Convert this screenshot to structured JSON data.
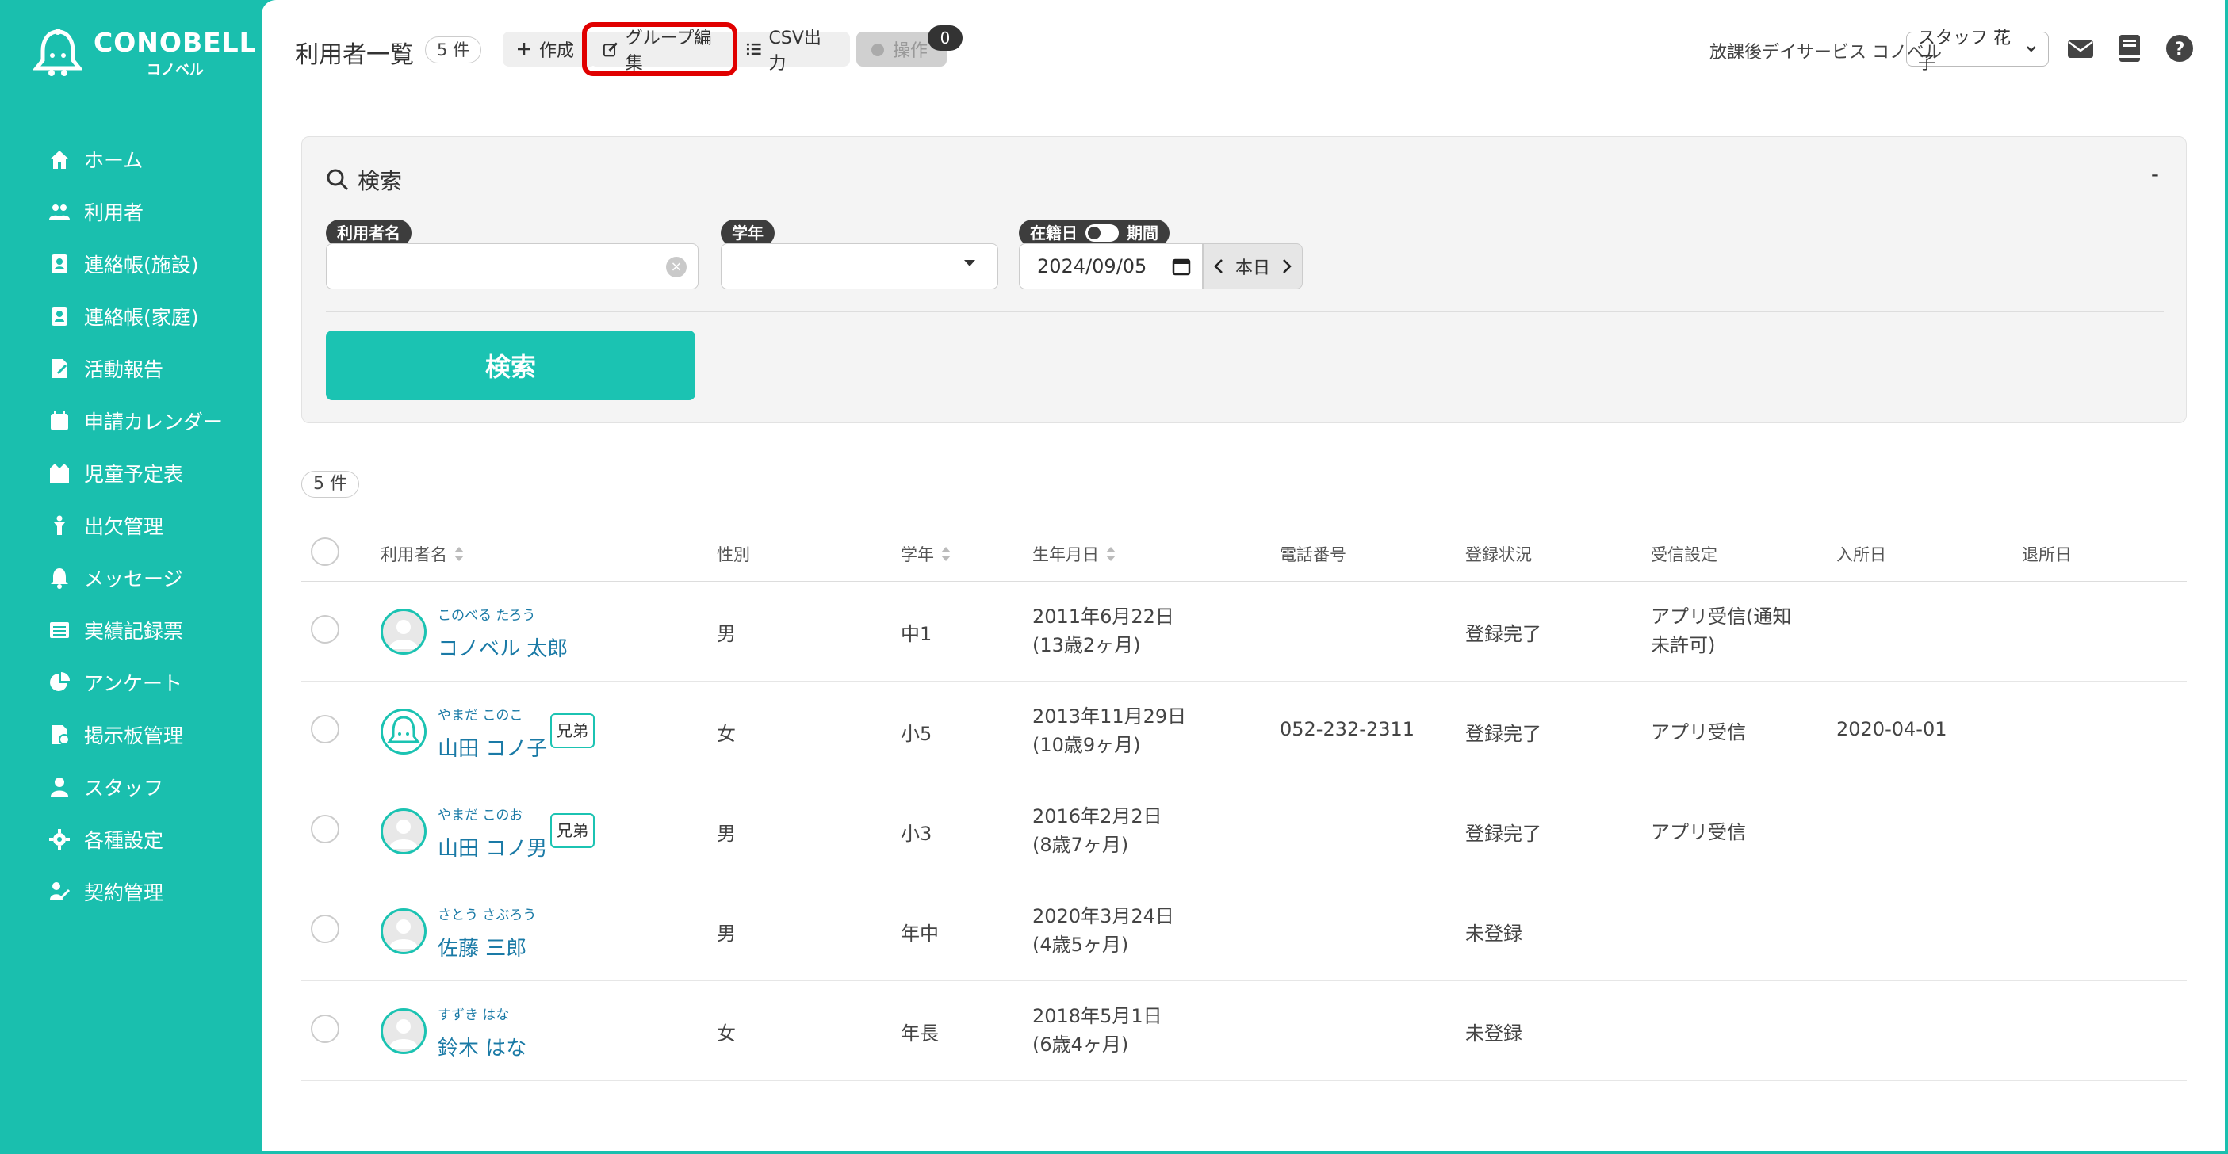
{
  "brand": {
    "name": "CONOBELL",
    "sub": "コノベル"
  },
  "sidebar": {
    "items": [
      {
        "label": "ホーム",
        "icon": "home-icon"
      },
      {
        "label": "利用者",
        "icon": "users-icon"
      },
      {
        "label": "連絡帳(施設)",
        "icon": "contact-book-icon"
      },
      {
        "label": "連絡帳(家庭)",
        "icon": "contact-book-icon"
      },
      {
        "label": "活動報告",
        "icon": "activity-icon"
      },
      {
        "label": "申請カレンダー",
        "icon": "calendar-icon"
      },
      {
        "label": "児童予定表",
        "icon": "schedule-icon"
      },
      {
        "label": "出欠管理",
        "icon": "attendance-icon"
      },
      {
        "label": "メッセージ",
        "icon": "bell-icon"
      },
      {
        "label": "実績記録票",
        "icon": "record-icon"
      },
      {
        "label": "アンケート",
        "icon": "pie-chart-icon"
      },
      {
        "label": "掲示板管理",
        "icon": "board-icon"
      },
      {
        "label": "スタッフ",
        "icon": "staff-icon"
      },
      {
        "label": "各種設定",
        "icon": "gear-icon"
      },
      {
        "label": "契約管理",
        "icon": "contract-icon"
      }
    ]
  },
  "header": {
    "title": "利用者一覧",
    "count": "5 件",
    "buttons": {
      "create": "作成",
      "group_edit": "グループ編集",
      "csv": "CSV出力",
      "ops": "操作"
    },
    "ops_badge": "0",
    "facility": "放課後デイサービス コノベル",
    "staff": "スタッフ 花子"
  },
  "search": {
    "title": "検索",
    "collapse": "-",
    "name_label": "利用者名",
    "name_value": "",
    "grade_label": "学年",
    "grade_value": "",
    "date_label_on": "在籍日",
    "date_label_off": "期間",
    "date_value": "2024/09/05",
    "today": "本日",
    "submit": "検索"
  },
  "results": {
    "count": "5 件",
    "columns": [
      "利用者名",
      "性別",
      "学年",
      "生年月日",
      "電話番号",
      "登録状況",
      "受信設定",
      "入所日",
      "退所日"
    ],
    "rows": [
      {
        "kana": "このべる たろう",
        "name": "コノベル 太郎",
        "sibling": "",
        "gender": "男",
        "grade": "中1",
        "birth": "2011年6月22日",
        "age": "(13歳2ヶ月)",
        "phone": "",
        "status": "登録完了",
        "receive1": "アプリ受信(通知",
        "receive2": "未許可)",
        "join": "",
        "leave": "",
        "avatar": "default"
      },
      {
        "kana": "やまだ このこ",
        "name": "山田 コノ子",
        "sibling": "兄弟",
        "gender": "女",
        "grade": "小5",
        "birth": "2013年11月29日",
        "age": "(10歳9ヶ月)",
        "phone": "052-232-2311",
        "status": "登録完了",
        "receive1": "アプリ受信",
        "receive2": "",
        "join": "2020-04-01",
        "leave": "",
        "avatar": "bell"
      },
      {
        "kana": "やまだ このお",
        "name": "山田 コノ男",
        "sibling": "兄弟",
        "gender": "男",
        "grade": "小3",
        "birth": "2016年2月2日",
        "age": "(8歳7ヶ月)",
        "phone": "",
        "status": "登録完了",
        "receive1": "アプリ受信",
        "receive2": "",
        "join": "",
        "leave": "",
        "avatar": "default"
      },
      {
        "kana": "さとう さぶろう",
        "name": "佐藤 三郎",
        "sibling": "",
        "gender": "男",
        "grade": "年中",
        "birth": "2020年3月24日",
        "age": "(4歳5ヶ月)",
        "phone": "",
        "status": "未登録",
        "receive1": "",
        "receive2": "",
        "join": "",
        "leave": "",
        "avatar": "default"
      },
      {
        "kana": "すずき はな",
        "name": "鈴木 はな",
        "sibling": "",
        "gender": "女",
        "grade": "年長",
        "birth": "2018年5月1日",
        "age": "(6歳4ヶ月)",
        "phone": "",
        "status": "未登録",
        "receive1": "",
        "receive2": "",
        "join": "",
        "leave": "",
        "avatar": "default"
      }
    ]
  },
  "colors": {
    "brand": "#1abfae",
    "highlight": "#e00000",
    "link": "#1a7aa6"
  }
}
